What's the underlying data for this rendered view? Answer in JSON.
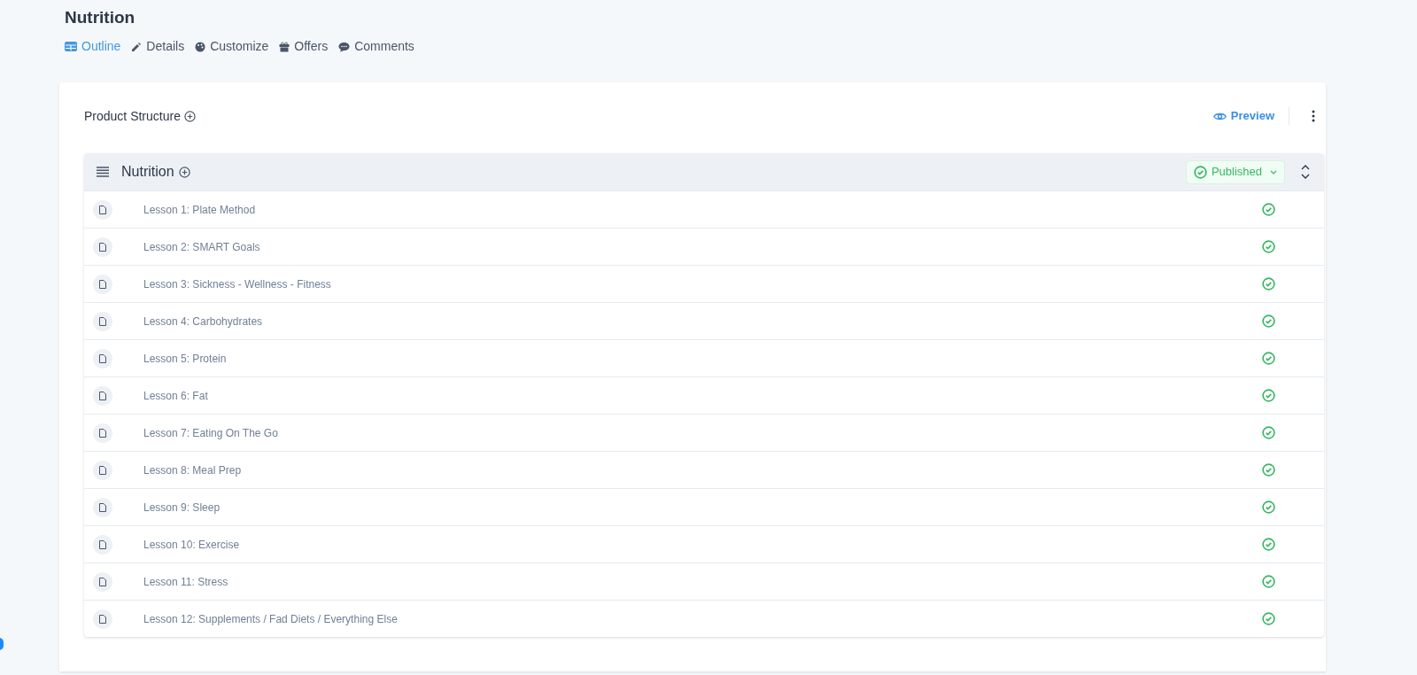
{
  "page_title": "Nutrition",
  "tabs": [
    {
      "label": "Outline",
      "kind": "table",
      "selected": true
    },
    {
      "label": "Details",
      "kind": "pencil",
      "selected": false
    },
    {
      "label": "Customize",
      "kind": "palette",
      "selected": false
    },
    {
      "label": "Offers",
      "kind": "gift",
      "selected": false
    },
    {
      "label": "Comments",
      "kind": "chat",
      "selected": false
    }
  ],
  "card": {
    "title": "Product Structure",
    "preview": "Preview",
    "module": {
      "title": "Nutrition",
      "status": "Published",
      "lessons": [
        {
          "title": "Lesson 1: Plate Method",
          "published": true
        },
        {
          "title": "Lesson 2: SMART Goals",
          "published": true
        },
        {
          "title": "Lesson 3: Sickness - Wellness - Fitness",
          "published": true
        },
        {
          "title": "Lesson 4: Carbohydrates",
          "published": true
        },
        {
          "title": "Lesson 5: Protein",
          "published": true
        },
        {
          "title": "Lesson 6: Fat",
          "published": true
        },
        {
          "title": "Lesson 7: Eating On The Go",
          "published": true
        },
        {
          "title": "Lesson 8: Meal Prep",
          "published": true
        },
        {
          "title": "Lesson 9: Sleep",
          "published": true
        },
        {
          "title": "Lesson 10: Exercise",
          "published": true
        },
        {
          "title": "Lesson 11: Stress",
          "published": true
        },
        {
          "title": "Lesson 12: Supplements / Fad Diets / Everything Else",
          "published": true
        }
      ]
    }
  }
}
